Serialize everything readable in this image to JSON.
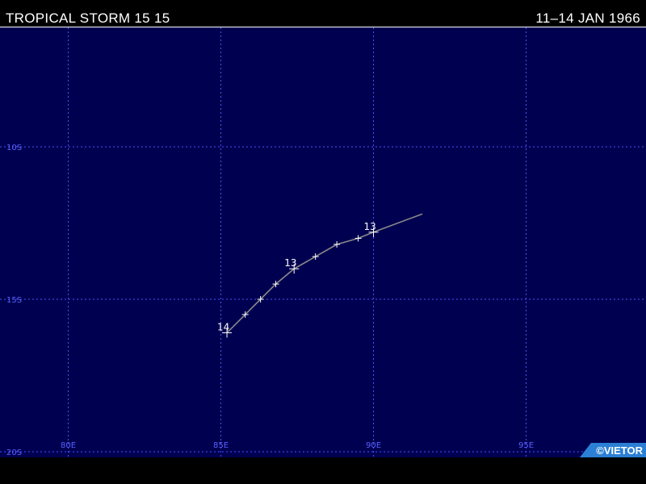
{
  "header": {
    "title": "TROPICAL STORM 15 15",
    "dates": "11–14  JAN 1966"
  },
  "map": {
    "background_color": "#000050",
    "grid_color": "#4a52ff",
    "track_color": "#8a8a8a",
    "marker_color": "#ffffff",
    "lon_range": [
      78,
      98
    ],
    "lat_range": [
      -20,
      -9
    ],
    "meridians": [
      {
        "lon": 80,
        "label": "80E"
      },
      {
        "lon": 85,
        "label": "85E"
      },
      {
        "lon": 90,
        "label": "90E"
      },
      {
        "lon": 95,
        "label": "95E"
      }
    ],
    "parallels": [
      {
        "lat": -10,
        "label": "10S"
      },
      {
        "lat": -15,
        "label": "15S"
      },
      {
        "lat": -20,
        "label": "20S"
      }
    ],
    "track": [
      {
        "lon": 91.6,
        "lat": -12.2
      },
      {
        "lon": 90.0,
        "lat": -12.8,
        "label": "13"
      },
      {
        "lon": 89.5,
        "lat": -13.0
      },
      {
        "lon": 88.8,
        "lat": -13.2
      },
      {
        "lon": 88.1,
        "lat": -13.6
      },
      {
        "lon": 87.4,
        "lat": -14.0,
        "label": "13"
      },
      {
        "lon": 86.8,
        "lat": -14.5
      },
      {
        "lon": 86.3,
        "lat": -15.0
      },
      {
        "lon": 85.8,
        "lat": -15.5
      },
      {
        "lon": 85.2,
        "lat": -16.1,
        "label": "14"
      }
    ]
  },
  "copyright": "©VIETOR"
}
